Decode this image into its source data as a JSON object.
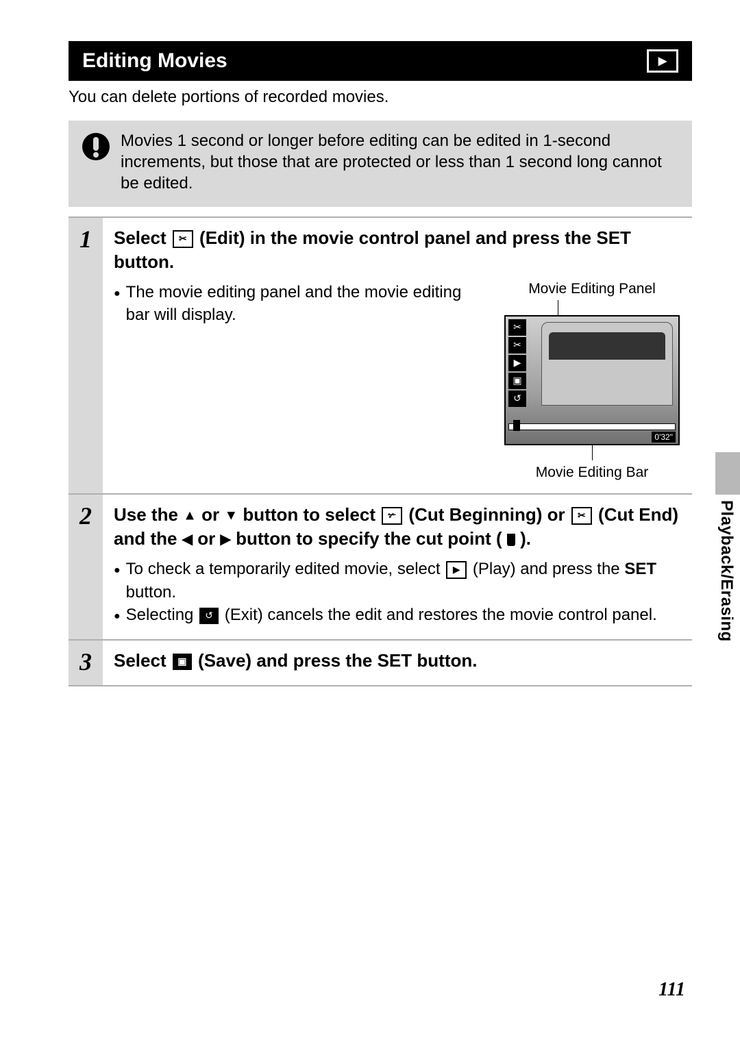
{
  "title": "Editing Movies",
  "intro": "You can delete portions of recorded movies.",
  "warning": "Movies 1 second or longer before editing can be edited in 1-second increments, but those that are protected or less than 1 second long cannot be edited.",
  "steps": {
    "s1": {
      "num": "1",
      "heading_a": "Select ",
      "heading_b": " (Edit) in the movie control panel and press the ",
      "heading_set": "SET",
      "heading_c": " button.",
      "bullet": "The movie editing panel and the movie editing bar will display.",
      "label_panel": "Movie Editing Panel",
      "label_bar": "Movie Editing Bar",
      "time": "0'32\""
    },
    "s2": {
      "num": "2",
      "h_a": "Use the ",
      "h_b": " or ",
      "h_c": " button to select ",
      "h_d": " (Cut Beginning) or ",
      "h_e": " (Cut End) and the ",
      "h_f": " or ",
      "h_g": " button to specify the cut point ( ",
      "h_h": " ).",
      "b1_a": "To check a temporarily edited movie, select ",
      "b1_b": " (Play) and press the ",
      "b1_set": "SET",
      "b1_c": " button.",
      "b2_a": "Selecting ",
      "b2_b": " (Exit) cancels the edit and restores the movie control panel."
    },
    "s3": {
      "num": "3",
      "h_a": "Select ",
      "h_b": " (Save) and press the ",
      "h_set": "SET",
      "h_c": " button."
    }
  },
  "side_tab": "Playback/Erasing",
  "page_number": "111",
  "icons": {
    "scissors": "✂",
    "cut_begin": "✃",
    "cut_end": "✂",
    "play": "▶",
    "save": "▣",
    "exit": "↺",
    "up": "▲",
    "down": "▼",
    "left": "◀",
    "right": "▶",
    "playback_tri": "▶"
  }
}
